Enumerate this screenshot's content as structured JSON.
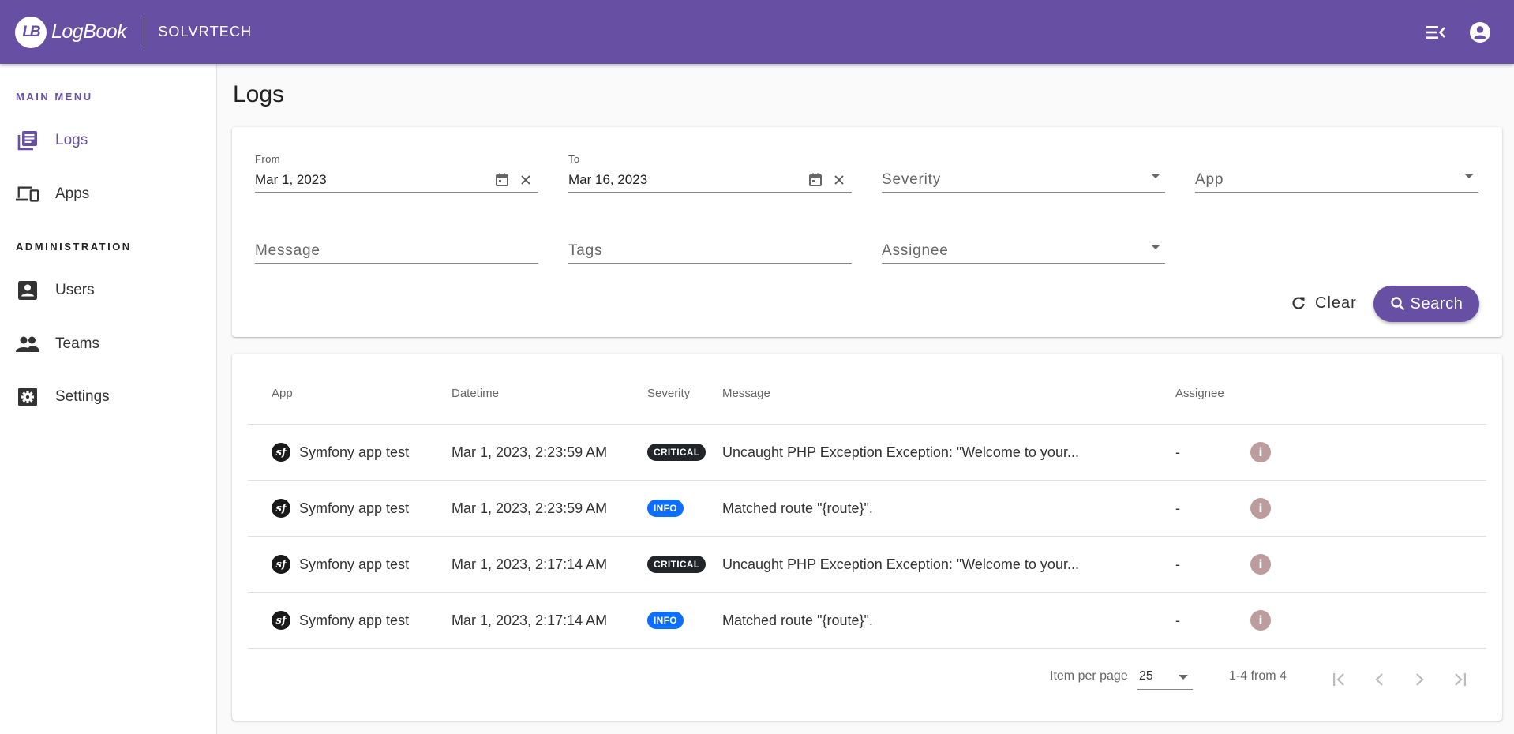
{
  "header": {
    "logo_text": "LB",
    "app_name": "LogBook",
    "org_name": "SOLVRTECH",
    "actions": [
      {
        "icon": "menu-collapse-icon"
      },
      {
        "icon": "account-circle-icon"
      }
    ]
  },
  "sidebar": {
    "main_title": "MAIN MENU",
    "admin_title": "ADMINISTRATION",
    "main_items": [
      {
        "label": "Logs",
        "icon": "logs-icon",
        "active": true
      },
      {
        "label": "Apps",
        "icon": "devices-icon",
        "active": false
      }
    ],
    "admin_items": [
      {
        "label": "Users",
        "icon": "user-card-icon"
      },
      {
        "label": "Teams",
        "icon": "people-icon"
      },
      {
        "label": "Settings",
        "icon": "settings-icon"
      }
    ]
  },
  "page": {
    "title": "Logs"
  },
  "filters": {
    "from": {
      "label": "From",
      "value": "Mar 1, 2023"
    },
    "to": {
      "label": "To",
      "value": "Mar 16, 2023"
    },
    "severity": {
      "placeholder": "Severity",
      "value": ""
    },
    "app": {
      "placeholder": "App",
      "value": ""
    },
    "message": {
      "placeholder": "Message",
      "value": ""
    },
    "tags": {
      "placeholder": "Tags",
      "value": ""
    },
    "assignee": {
      "placeholder": "Assignee",
      "value": ""
    },
    "clear_label": "Clear",
    "search_label": "Search"
  },
  "table": {
    "columns": [
      "App",
      "Datetime",
      "Severity",
      "Message",
      "Assignee"
    ],
    "rows": [
      {
        "app": "Symfony app test",
        "datetime": "Mar 1, 2023, 2:23:59 AM",
        "severity": "CRITICAL",
        "message": "Uncaught PHP Exception Exception: \"Welcome to your...",
        "assignee": "-"
      },
      {
        "app": "Symfony app test",
        "datetime": "Mar 1, 2023, 2:23:59 AM",
        "severity": "INFO",
        "message": "Matched route \"{route}\".",
        "assignee": "-"
      },
      {
        "app": "Symfony app test",
        "datetime": "Mar 1, 2023, 2:17:14 AM",
        "severity": "CRITICAL",
        "message": "Uncaught PHP Exception Exception: \"Welcome to your...",
        "assignee": "-"
      },
      {
        "app": "Symfony app test",
        "datetime": "Mar 1, 2023, 2:17:14 AM",
        "severity": "INFO",
        "message": "Matched route \"{route}\".",
        "assignee": "-"
      }
    ],
    "severity_colors": {
      "CRITICAL": "#212529",
      "INFO": "#0d6efd"
    },
    "app_icon_text": "sf"
  },
  "pagination": {
    "items_per_page_label": "Item per page",
    "items_per_page": "25",
    "range_text": "1-4 from 4"
  },
  "colors": {
    "primary": "#6750a4",
    "info_button": "#bd9c9d"
  }
}
